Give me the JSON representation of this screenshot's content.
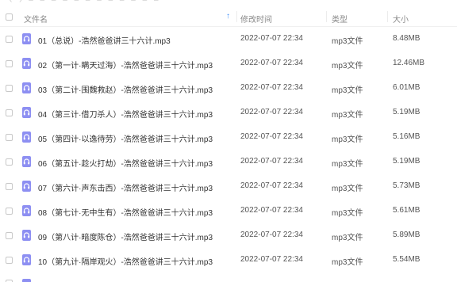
{
  "topbar": {
    "text": "‹ › – – – – – – – – – – – –"
  },
  "header": {
    "name": "文件名",
    "time": "修改时间",
    "type": "类型",
    "size": "大小",
    "sort_arrow": "↑"
  },
  "files": [
    {
      "name": "01（总说）-浩然爸爸讲三十六计.mp3",
      "time": "2022-07-07 22:34",
      "type": "mp3文件",
      "size": "8.48MB"
    },
    {
      "name": "02（第一计·瞒天过海）-浩然爸爸讲三十六计.mp3",
      "time": "2022-07-07 22:34",
      "type": "mp3文件",
      "size": "12.46MB"
    },
    {
      "name": "03（第二计·围魏救赵）-浩然爸爸讲三十六计.mp3",
      "time": "2022-07-07 22:34",
      "type": "mp3文件",
      "size": "6.01MB"
    },
    {
      "name": "04（第三计·借刀杀人）-浩然爸爸讲三十六计.mp3",
      "time": "2022-07-07 22:34",
      "type": "mp3文件",
      "size": "5.19MB"
    },
    {
      "name": "05（第四计·以逸待劳）-浩然爸爸讲三十六计.mp3",
      "time": "2022-07-07 22:34",
      "type": "mp3文件",
      "size": "5.16MB"
    },
    {
      "name": "06（第五计·趁火打劫）-浩然爸爸讲三十六计.mp3",
      "time": "2022-07-07 22:34",
      "type": "mp3文件",
      "size": "5.19MB"
    },
    {
      "name": "07（第六计·声东击西）-浩然爸爸讲三十六计.mp3",
      "time": "2022-07-07 22:34",
      "type": "mp3文件",
      "size": "5.73MB"
    },
    {
      "name": "08（第七计·无中生有）-浩然爸爸讲三十六计.mp3",
      "time": "2022-07-07 22:34",
      "type": "mp3文件",
      "size": "5.61MB"
    },
    {
      "name": "09（第八计·暗度陈仓）-浩然爸爸讲三十六计.mp3",
      "time": "2022-07-07 22:34",
      "type": "mp3文件",
      "size": "5.89MB"
    },
    {
      "name": "10（第九计·隔岸观火）-浩然爸爸讲三十六计.mp3",
      "time": "2022-07-07 22:34",
      "type": "mp3文件",
      "size": "5.54MB"
    }
  ],
  "colors": {
    "icon": "#8d8ff2",
    "accent": "#3a8dfb"
  },
  "icons": {
    "file": "headphones-icon",
    "sort": "sort-up-arrow-icon"
  }
}
